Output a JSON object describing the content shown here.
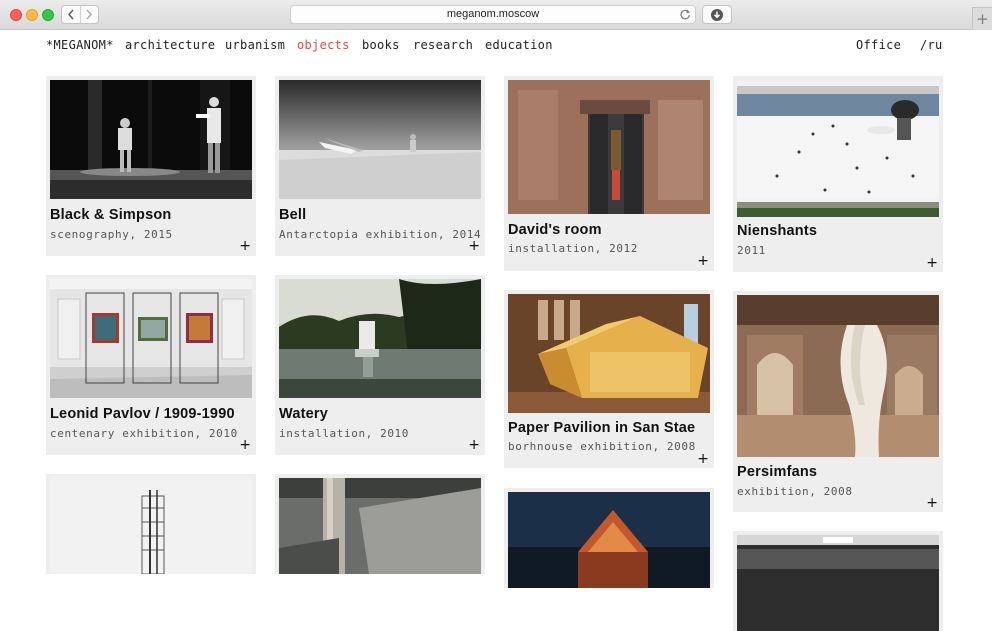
{
  "browser": {
    "url": "meganom.moscow",
    "back_icon": "chevron-left-icon",
    "forward_icon": "chevron-right-icon",
    "reload_icon": "reload-icon",
    "download_icon": "download-icon",
    "new_tab_label": "+"
  },
  "nav": {
    "logo": "*MEGANOM*",
    "items": [
      "architecture",
      "urbanism",
      "objects",
      "books",
      "research",
      "education"
    ],
    "active": "objects",
    "office": "Office",
    "lang": "/ru"
  },
  "colors": {
    "accent": "#e5463f",
    "card_bg": "#eeeeee",
    "text": "#111111"
  },
  "projects": [
    {
      "title": "Black & Simpson",
      "subtitle": "scenography, 2015"
    },
    {
      "title": "Bell",
      "subtitle": "Antarctopia exhibition, 2014"
    },
    {
      "title": "David's room",
      "subtitle": "installation, 2012"
    },
    {
      "title": "Nienshants",
      "subtitle": "2011"
    },
    {
      "title": "Leonid Pavlov / 1909-1990",
      "subtitle": "centenary exhibition, 2010"
    },
    {
      "title": "Watery",
      "subtitle": "installation, 2010"
    },
    {
      "title": "Paper Pavilion in San Stae",
      "subtitle": "borhnouse exhibition, 2008"
    },
    {
      "title": "Persimfans",
      "subtitle": "exhibition, 2008"
    }
  ],
  "expand_label": "+"
}
